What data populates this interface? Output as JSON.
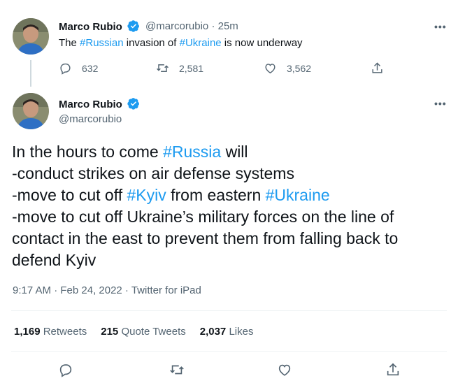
{
  "tweet1": {
    "author_name": "Marco Rubio",
    "handle": "@marcorubio",
    "separator": "·",
    "time_ago": "25m",
    "text_parts": {
      "p1": "The ",
      "tag1": "#Russian",
      "p2": " invasion of ",
      "tag2": "#Ukraine",
      "p3": " is now underway"
    },
    "replies": "632",
    "retweets": "2,581",
    "likes": "3,562"
  },
  "tweet2": {
    "author_name": "Marco Rubio",
    "handle": "@marcorubio",
    "lines": {
      "l1a": "In the hours to come ",
      "l1tag": "#Russia",
      "l1b": " will",
      "l2": "-conduct strikes on air defense systems",
      "l3a": "-move to cut off ",
      "l3tag1": "#Kyiv",
      "l3b": " from eastern ",
      "l3tag2": "#Ukraine",
      "l4": "-move to cut off Ukraine’s military forces on the line of",
      "l5": "contact in the east to prevent them from falling back to",
      "l6": "defend Kyiv"
    },
    "timestamp": "9:17 AM · Feb 24, 2022 · Twitter for iPad",
    "stats": {
      "retweets_count": "1,169",
      "retweets_label": "Retweets",
      "quotes_count": "215",
      "quotes_label": "Quote Tweets",
      "likes_count": "2,037",
      "likes_label": "Likes"
    }
  },
  "colors": {
    "link": "#1d9bf0",
    "muted": "#536471",
    "text": "#0f1419",
    "divider": "#eff3f4"
  },
  "icons": [
    "verified-badge-icon",
    "more-icon",
    "reply-icon",
    "retweet-icon",
    "like-icon",
    "share-icon"
  ]
}
